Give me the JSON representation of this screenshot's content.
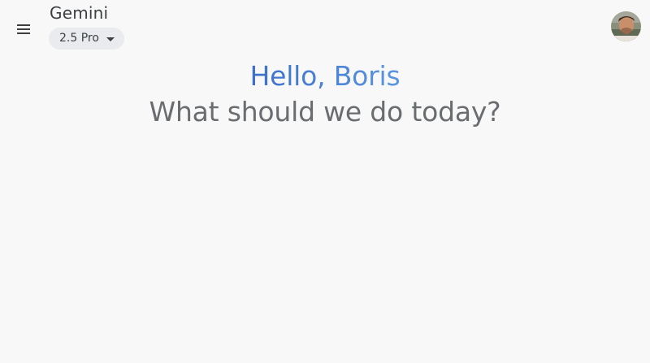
{
  "header": {
    "app_title": "Gemini",
    "model_picker": {
      "selected": "2.5 Pro",
      "caret_icon": "arrow-drop-down-icon"
    },
    "menu_icon": "hamburger-menu-icon",
    "avatar_icon": "user-avatar"
  },
  "main": {
    "greeting": "Hello, Boris",
    "prompt": "What should we do today?"
  },
  "colors": {
    "background": "#f8f8f8",
    "greeting_accent": "#4a7fd3",
    "prompt_text": "#6a6d70",
    "chip_background": "#e9ebee"
  }
}
